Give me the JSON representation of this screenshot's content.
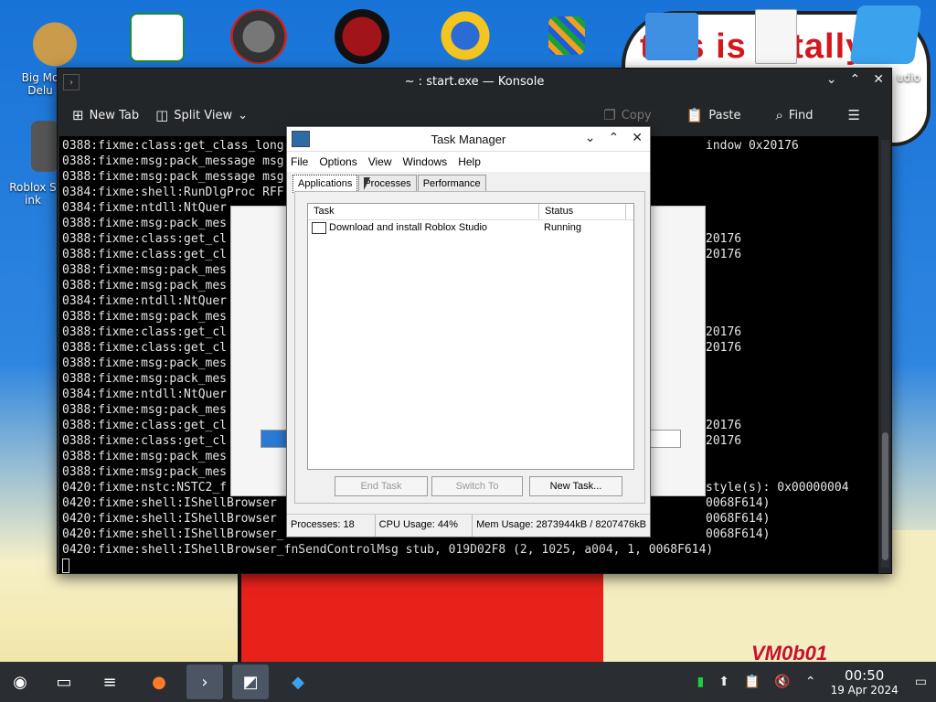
{
  "desktop": {
    "icons": [
      {
        "label": "Big Mo Delu",
        "icon": "money-bag-icon"
      },
      {
        "label": "",
        "icon": "media-player-icon"
      },
      {
        "label": "",
        "icon": "speedometer-icon"
      },
      {
        "label": "",
        "icon": "red-bird-icon"
      },
      {
        "label": "",
        "icon": "sun-globe-icon"
      },
      {
        "label": "",
        "icon": "colorful-grid-icon"
      },
      {
        "label": "",
        "icon": "folder-icon"
      },
      {
        "label": "",
        "icon": "document-icon"
      },
      {
        "label": "udio",
        "icon": "roblox-studio-icon"
      },
      {
        "label": "Roblox S ink",
        "icon": "roblox-shortcut-icon"
      }
    ],
    "wallpaper_text": "this is totally",
    "watermark": "VM0b01"
  },
  "konsole": {
    "title": "~ : start.exe — Konsole",
    "toolbar": {
      "new_tab": "New Tab",
      "split_view": "Split View",
      "copy": "Copy",
      "paste": "Paste",
      "find": "Find"
    },
    "lines": [
      "0388:fixme:class:get_class_long",
      "0388:fixme:msg:pack_message msg",
      "0388:fixme:msg:pack_message msg",
      "0384:fixme:shell:RunDlgProc RFF",
      "0384:fixme:ntdll:NtQuer",
      "0388:fixme:msg:pack_mes",
      "0388:fixme:class:get_cl",
      "0388:fixme:class:get_cl",
      "0388:fixme:msg:pack_mes",
      "0388:fixme:msg:pack_mes",
      "0384:fixme:ntdll:NtQuer",
      "0388:fixme:msg:pack_mes",
      "0388:fixme:class:get_cl",
      "0388:fixme:class:get_cl",
      "0388:fixme:msg:pack_mes",
      "0388:fixme:msg:pack_mes",
      "0384:fixme:ntdll:NtQuer",
      "0388:fixme:msg:pack_mes",
      "0388:fixme:class:get_cl",
      "0388:fixme:class:get_cl",
      "0388:fixme:msg:pack_mes",
      "0388:fixme:msg:pack_mes",
      "0420:fixme:nstc:NSTC2_f",
      "0420:fixme:shell:IShellBrowser",
      "0420:fixme:shell:IShellBrowser",
      "0420:fixme:shell:IShellBrowser_",
      "0420:fixme:shell:IShellBrowser_fnSendControlMsg stub, 019D02F8 (2, 1025, a004, 1, 0068F614)"
    ],
    "right_fragments": [
      {
        "row": 0,
        "text": "indow 0x20176"
      },
      {
        "row": 6,
        "text": "20176"
      },
      {
        "row": 7,
        "text": "20176"
      },
      {
        "row": 12,
        "text": "20176"
      },
      {
        "row": 13,
        "text": "20176"
      },
      {
        "row": 18,
        "text": "20176"
      },
      {
        "row": 19,
        "text": "20176"
      },
      {
        "row": 22,
        "text": "style(s): 0x00000004"
      },
      {
        "row": 23,
        "text": "0068F614)"
      },
      {
        "row": 24,
        "text": "0068F614)"
      },
      {
        "row": 25,
        "text": "0068F614)"
      }
    ]
  },
  "taskmanager": {
    "title": "Task Manager",
    "menu": [
      "File",
      "Options",
      "View",
      "Windows",
      "Help"
    ],
    "tabs": [
      "Applications",
      "Processes",
      "Performance"
    ],
    "columns": {
      "task": "Task",
      "status": "Status"
    },
    "rows": [
      {
        "task": "Download and install Roblox Studio",
        "status": "Running"
      }
    ],
    "buttons": {
      "end_task": "End Task",
      "switch_to": "Switch To",
      "new_task": "New Task..."
    },
    "status": {
      "processes": "Processes: 18",
      "cpu": "CPU Usage:  44%",
      "mem": "Mem Usage:  2873944kB / 8207476kB"
    }
  },
  "installer": {
    "progress": 0.82
  },
  "taskbar": {
    "items": [
      "start-icon",
      "file-manager-icon",
      "settings-icon",
      "firefox-icon",
      "terminal-icon",
      "task-manager-icon",
      "roblox-icon"
    ],
    "clock_time": "00:50",
    "clock_date": "19 Apr 2024"
  }
}
